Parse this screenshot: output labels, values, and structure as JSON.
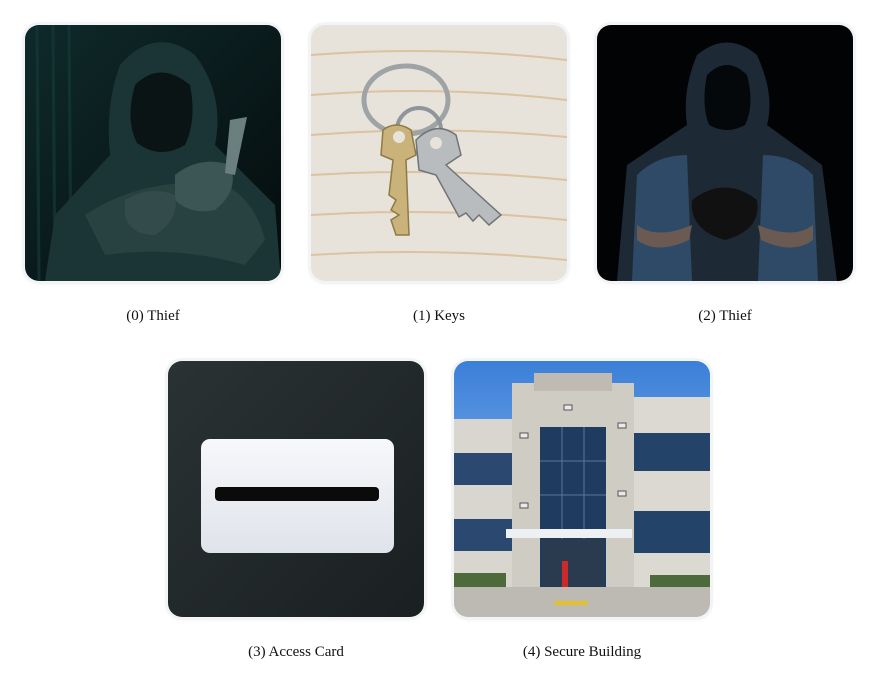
{
  "items": [
    {
      "index": "0",
      "label": "(0) Thief",
      "image": "hooded-thief-holding-knife"
    },
    {
      "index": "1",
      "label": "(1) Keys",
      "image": "keyring-with-keys-on-wood"
    },
    {
      "index": "2",
      "label": "(2) Thief",
      "image": "hooded-thief-in-shadow"
    },
    {
      "index": "3",
      "label": "(3) Access Card",
      "image": "white-access-card-on-dark"
    },
    {
      "index": "4",
      "label": "(4) Secure Building",
      "image": "office-building-with-cameras"
    }
  ],
  "colors": {
    "background": "#ffffff",
    "caption_text": "#111111"
  }
}
